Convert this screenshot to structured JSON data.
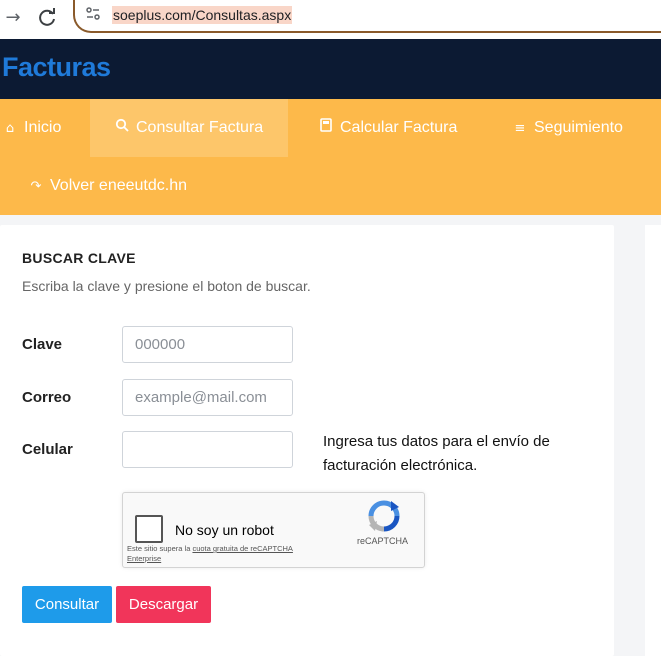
{
  "browser": {
    "url": "soeplus.com/Consultas.aspx"
  },
  "app": {
    "title": "Facturas"
  },
  "menu": {
    "items": [
      {
        "label": "Inicio",
        "icon": "home-icon"
      },
      {
        "label": "Consultar Factura",
        "icon": "search-icon",
        "active": true
      },
      {
        "label": "Calcular Factura",
        "icon": "calculator-icon"
      },
      {
        "label": "Seguimiento",
        "icon": "list-icon"
      },
      {
        "label": "Volver eneeutdc.hn",
        "icon": "return-arrow-icon"
      }
    ]
  },
  "card": {
    "title": "BUSCAR CLAVE",
    "subtitle": "Escriba la clave y presione el boton de buscar."
  },
  "form": {
    "clave": {
      "label": "Clave",
      "placeholder": "000000",
      "value": ""
    },
    "correo": {
      "label": "Correo",
      "placeholder": "example@mail.com",
      "value": ""
    },
    "celular": {
      "label": "Celular",
      "placeholder": "",
      "value": ""
    },
    "note": "Ingresa tus datos para el envío de facturación electrónica."
  },
  "captcha": {
    "label": "No soy un robot",
    "brand": "reCAPTCHA",
    "fine_prefix": "Este sitio supera la ",
    "fine_link": "cuota gratuita de reCAPTCHA Enterprise"
  },
  "buttons": {
    "consultar": "Consultar",
    "descargar": "Descargar"
  },
  "colors": {
    "header_bg": "#0c1a33",
    "title_blue": "#1f7ad9",
    "menu_bg": "#fdb94a",
    "consultar_btn": "#1e9bea",
    "descargar_btn": "#f1355a"
  }
}
